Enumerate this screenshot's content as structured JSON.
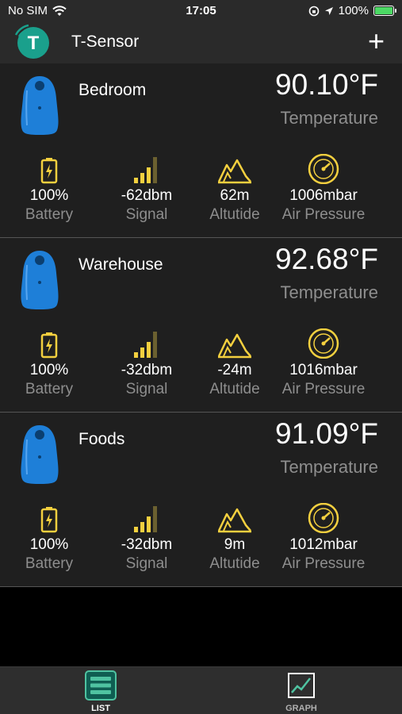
{
  "status": {
    "carrier": "No SIM",
    "time": "17:05",
    "battery": "100%"
  },
  "header": {
    "title": "T-Sensor",
    "logo_letter": "T",
    "add_label": "+"
  },
  "labels": {
    "temperature": "Temperature",
    "battery": "Battery",
    "signal": "Signal",
    "altitude": "Altutide",
    "pressure": "Air Pressure"
  },
  "sensors": [
    {
      "name": "Bedroom",
      "temperature": "90.10°F",
      "battery": "100%",
      "signal": "-62dbm",
      "altitude": "62m",
      "pressure": "1006mbar"
    },
    {
      "name": "Warehouse",
      "temperature": "92.68°F",
      "battery": "100%",
      "signal": "-32dbm",
      "altitude": "-24m",
      "pressure": "1016mbar"
    },
    {
      "name": "Foods",
      "temperature": "91.09°F",
      "battery": "100%",
      "signal": "-32dbm",
      "altitude": "9m",
      "pressure": "1012mbar"
    }
  ],
  "tabs": [
    {
      "label": "LIST",
      "icon": "list-icon",
      "active": true
    },
    {
      "label": "GRAPH",
      "icon": "graph-icon",
      "active": false
    }
  ],
  "colors": {
    "accent_yellow": "#f4d03f",
    "teal": "#1aa08c",
    "sensor_blue": "#1e7fd8",
    "active_tab": "#4fc3a1",
    "inactive_tab": "#b0b0b0"
  }
}
